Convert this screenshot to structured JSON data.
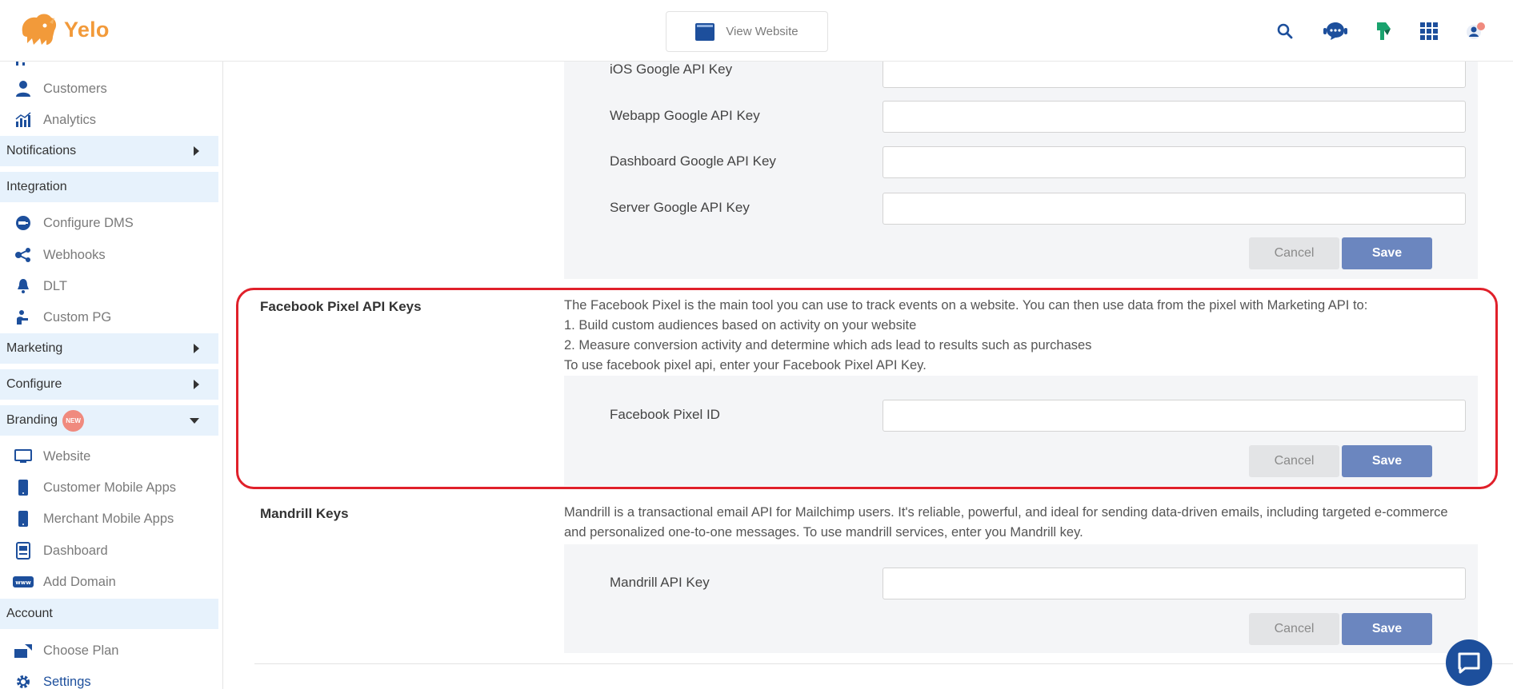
{
  "app": {
    "logo_text": "Yelo",
    "view_website_label": "View Website",
    "brand_color": "#1d4f9c",
    "accent_color": "#f29a3a"
  },
  "header_icons": [
    "search-icon",
    "support-chat-icon",
    "marketplace-icon",
    "apps-grid-icon",
    "profile-icon"
  ],
  "sidebar": {
    "items_top": [
      {
        "label": "Customers",
        "icon": "customer-icon"
      },
      {
        "label": "Analytics",
        "icon": "analytics-icon"
      }
    ],
    "sections": {
      "notifications": "Notifications",
      "integration": "Integration",
      "marketing": "Marketing",
      "configure": "Configure",
      "branding": "Branding",
      "account": "Account"
    },
    "branding_badge": "NEW",
    "integration_items": [
      {
        "label": "Configure DMS",
        "icon": "dms-icon"
      },
      {
        "label": "Webhooks",
        "icon": "webhooks-icon"
      },
      {
        "label": "DLT",
        "icon": "bell-icon"
      },
      {
        "label": "Custom PG",
        "icon": "payment-gateway-icon"
      }
    ],
    "branding_items": [
      {
        "label": "Website",
        "icon": "monitor-icon"
      },
      {
        "label": "Customer Mobile Apps",
        "icon": "mobile-icon"
      },
      {
        "label": "Merchant Mobile Apps",
        "icon": "mobile-icon"
      },
      {
        "label": "Dashboard",
        "icon": "dashboard-icon"
      },
      {
        "label": "Add Domain",
        "icon": "www-icon"
      }
    ],
    "account_items": [
      {
        "label": "Choose Plan",
        "icon": "plan-icon"
      },
      {
        "label": "Settings",
        "icon": "gear-icon"
      }
    ]
  },
  "google_keys": {
    "fields": [
      {
        "label": "iOS Google API Key",
        "value": ""
      },
      {
        "label": "Webapp Google API Key",
        "value": ""
      },
      {
        "label": "Dashboard Google API Key",
        "value": ""
      },
      {
        "label": "Server Google API Key",
        "value": ""
      }
    ],
    "cancel_label": "Cancel",
    "save_label": "Save"
  },
  "facebook_pixel": {
    "title": "Facebook Pixel API Keys",
    "description": [
      "The Facebook Pixel is the main tool you can use to track events on a website. You can then use data from the pixel with Marketing API to:",
      "1. Build custom audiences based on activity on your website",
      "2. Measure conversion activity and determine which ads lead to results such as purchases",
      "To use facebook pixel api, enter your Facebook Pixel API Key."
    ],
    "field_label": "Facebook Pixel ID",
    "field_value": "",
    "cancel_label": "Cancel",
    "save_label": "Save",
    "highlight_color": "#e0202a"
  },
  "mandrill": {
    "title": "Mandrill Keys",
    "description": [
      "Mandrill is a transactional email API for Mailchimp users. It's reliable, powerful, and ideal for sending data-driven emails, including targeted e-commerce",
      "and personalized one-to-one messages. To use mandrill services, enter you Mandrill key."
    ],
    "field_label": "Mandrill API Key",
    "field_value": "",
    "cancel_label": "Cancel",
    "save_label": "Save"
  },
  "chat_widget_icon": "chat-bubble-icon"
}
